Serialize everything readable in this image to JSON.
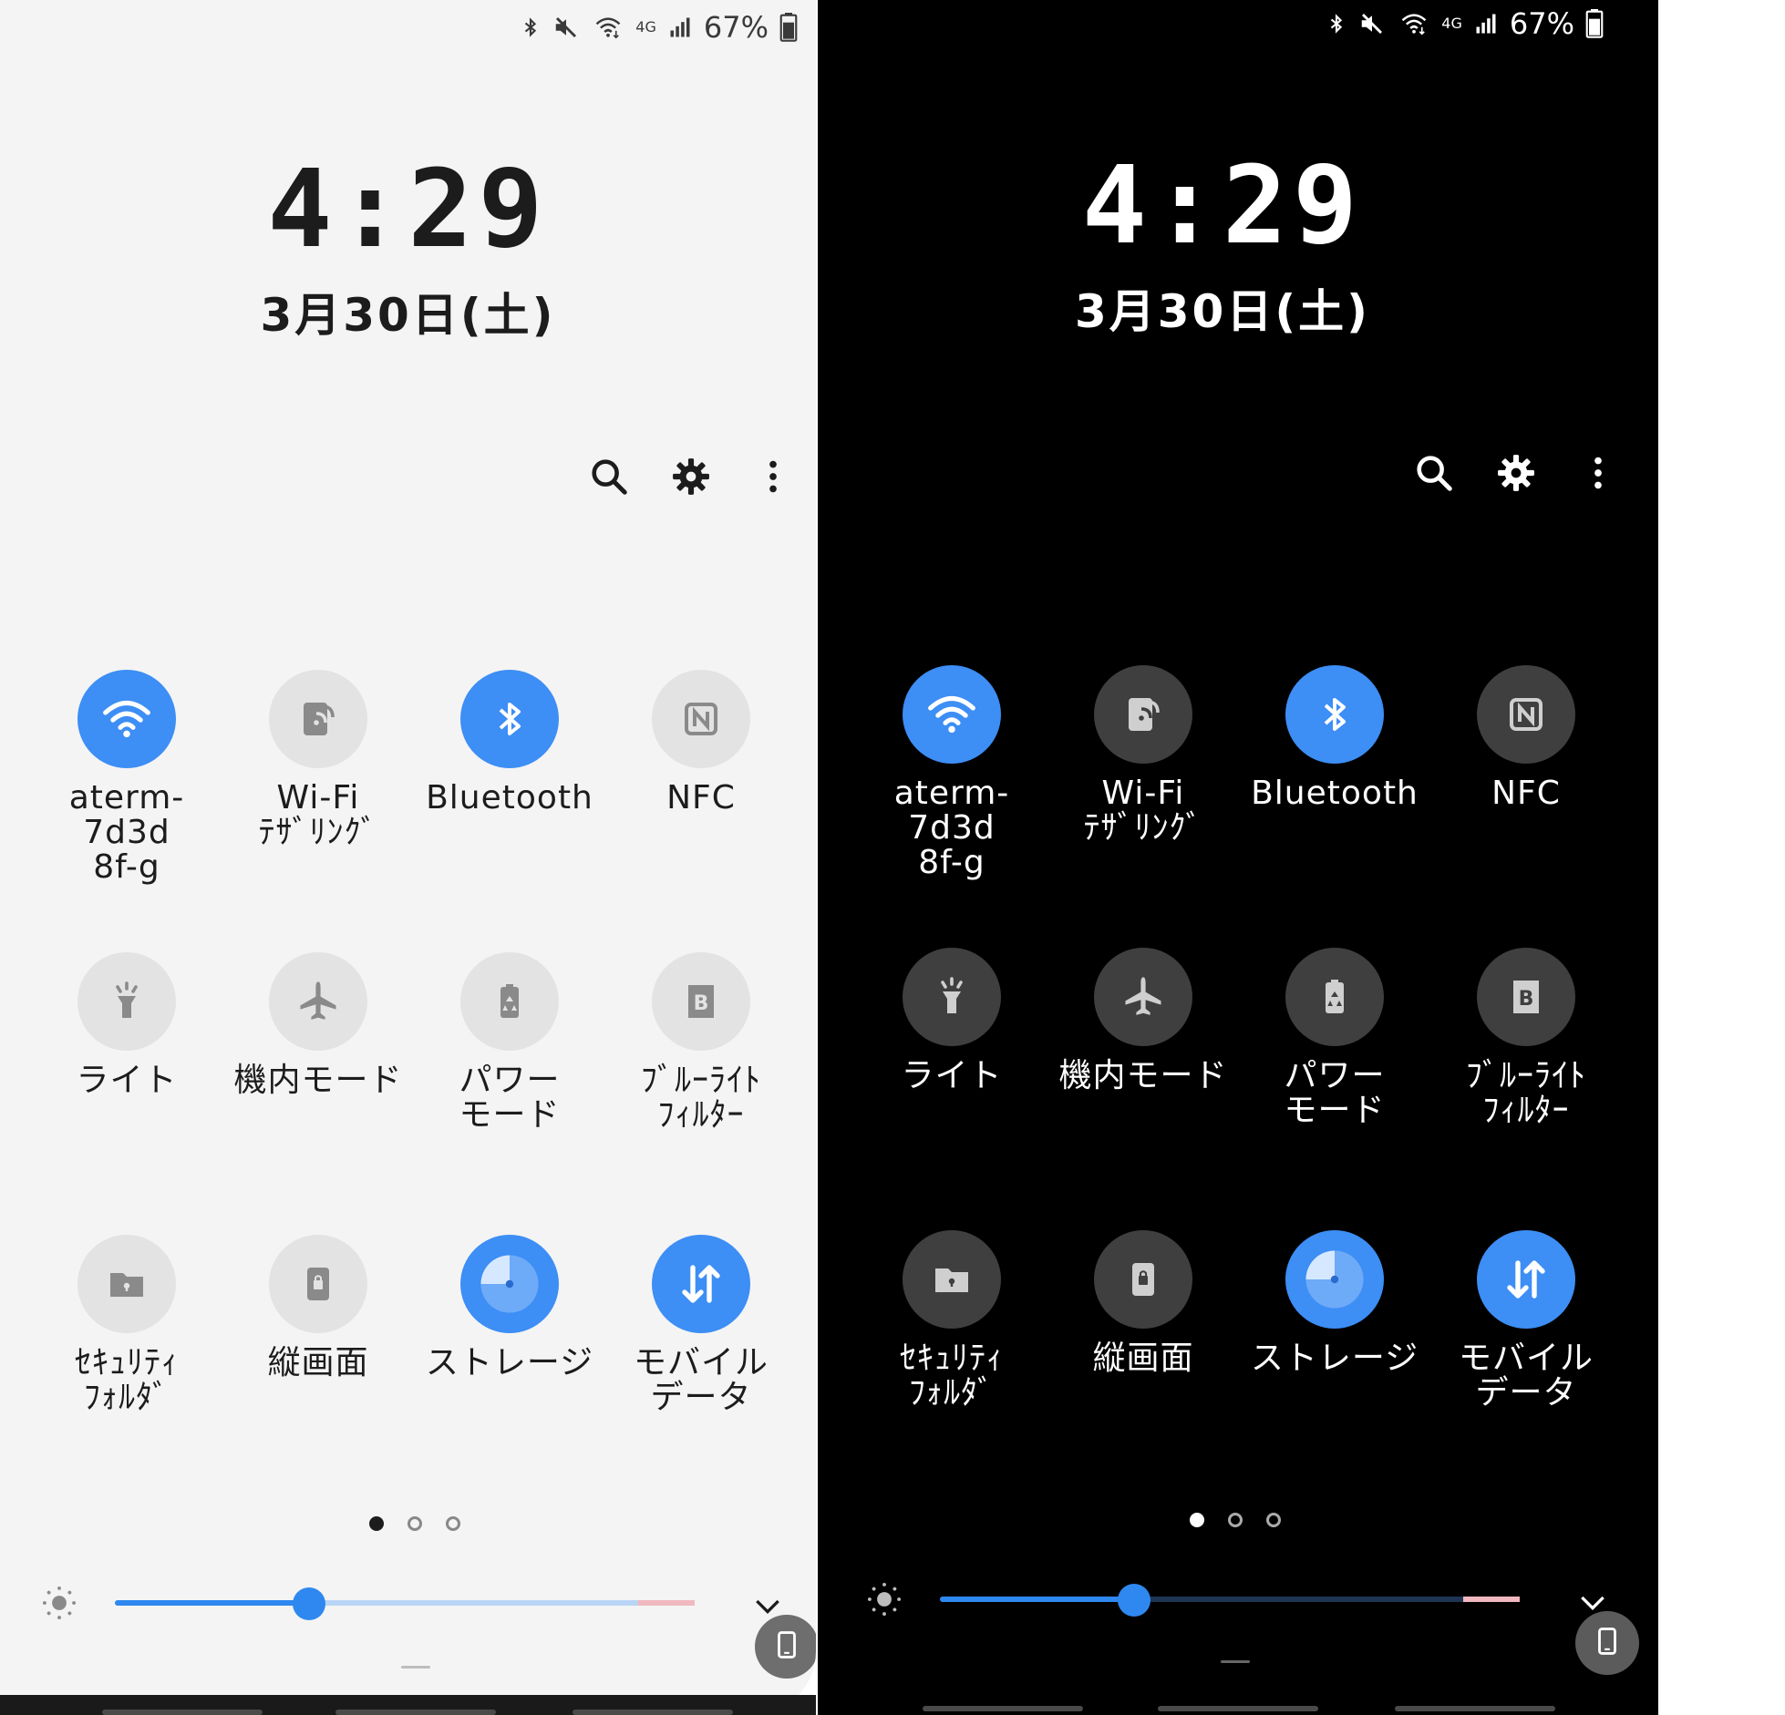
{
  "status_bar": {
    "network": "4G",
    "battery": "67%"
  },
  "clock": {
    "time": "4:29",
    "date": "3月30日(土)"
  },
  "actions": {
    "search_icon": "search-icon",
    "settings_icon": "gear-icon",
    "more_icon": "more-vertical-icon"
  },
  "tiles": [
    {
      "label": "aterm-7d3d\n8f-g",
      "icon": "wifi-icon",
      "active": true
    },
    {
      "label": "Wi-Fi\nﾃｻﾞﾘﾝｸﾞ",
      "icon": "hotspot-icon",
      "active": false
    },
    {
      "label": "Bluetooth",
      "icon": "bluetooth-icon",
      "active": true
    },
    {
      "label": "NFC",
      "icon": "nfc-icon",
      "active": false
    },
    {
      "label": "ライト",
      "icon": "flashlight-icon",
      "active": false
    },
    {
      "label": "機内モード",
      "icon": "airplane-icon",
      "active": false
    },
    {
      "label": "パワー\nモード",
      "icon": "power-mode-icon",
      "active": false
    },
    {
      "label": "ﾌﾞﾙｰﾗｲﾄ\nﾌｨﾙﾀｰ",
      "icon": "blue-light-filter-icon",
      "active": false
    },
    {
      "label": "ｾｷｭﾘﾃｨ\nﾌｫﾙﾀﾞ",
      "icon": "secure-folder-icon",
      "active": false
    },
    {
      "label": "縦画面",
      "icon": "portrait-lock-icon",
      "active": false
    },
    {
      "label": "ストレージ",
      "icon": "storage-icon",
      "active": true
    },
    {
      "label": "モバイル\nデータ",
      "icon": "mobile-data-icon",
      "active": true
    }
  ],
  "pager": {
    "pages": 3,
    "current": 1
  },
  "brightness": {
    "level_fraction": 0.335
  },
  "colors": {
    "accent": "#3d8ef5",
    "light_bg": "#f4f4f4",
    "dark_bg": "#000000"
  }
}
